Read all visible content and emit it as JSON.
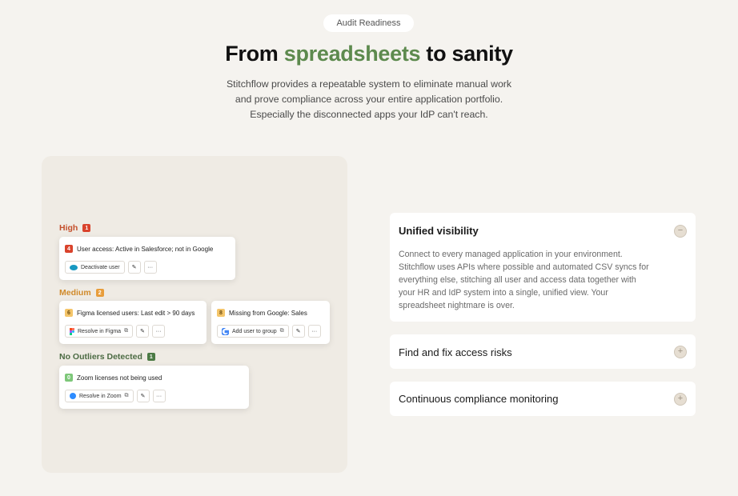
{
  "hero": {
    "pill": "Audit Readiness",
    "headline_pre": "From ",
    "headline_accent": "spreadsheets",
    "headline_post": " to sanity",
    "subtitle_lines": [
      "Stitchflow provides a repeatable system to eliminate manual work",
      "and prove compliance across your entire application portfolio.",
      "Especially the disconnected apps your IdP can't reach."
    ]
  },
  "panel": {
    "groups": [
      {
        "label": "High",
        "count": "1"
      },
      {
        "label": "Medium",
        "count": "2"
      },
      {
        "label": "No Outliers Detected",
        "count": "1"
      }
    ],
    "cards": [
      {
        "count": "4",
        "title": "User access: Active in Salesforce; not in Google",
        "action": "Deactivate user",
        "action_icon": "salesforce-icon"
      },
      {
        "count": "6",
        "title": "Figma licensed users: Last edit > 90 days",
        "action": "Resolve in Figma",
        "action_icon": "figma-icon"
      },
      {
        "count": "8",
        "title": "Missing from Google: Sales",
        "action": "Add user to group",
        "action_icon": "google-icon"
      },
      {
        "count": "0",
        "title": "Zoom licenses not being used",
        "action": "Resolve in Zoom",
        "action_icon": "zoom-icon"
      }
    ],
    "edit_glyph": "✎",
    "more_glyph": "···",
    "external_glyph": "⧉"
  },
  "accordion": [
    {
      "title": "Unified visibility",
      "expanded": true,
      "toggle": "−",
      "body_lines": [
        "Connect to every managed application in your environment.",
        "Stitchflow uses APIs where possible and automated CSV syncs for",
        "everything else, stitching all user and access data together with",
        "your HR and IdP system into a single, unified view. Your",
        "spreadsheet nightmare is over."
      ]
    },
    {
      "title": "Find and fix access risks",
      "expanded": false,
      "toggle": "+"
    },
    {
      "title": "Continuous compliance monitoring",
      "expanded": false,
      "toggle": "+"
    }
  ],
  "colors": {
    "accent": "#5d8a4e",
    "high": "#d9432c",
    "medium": "#e89d3b",
    "none": "#4c7a45"
  }
}
